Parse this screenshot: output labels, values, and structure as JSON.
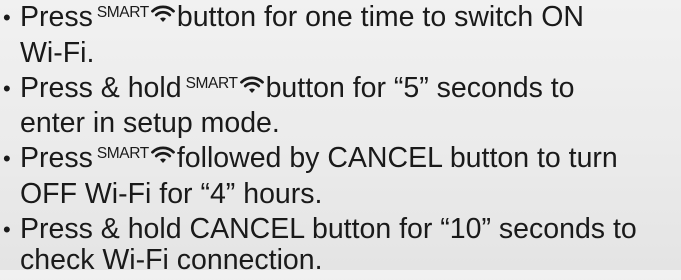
{
  "instructions": [
    {
      "line1_pre": "Press",
      "smart_label": "SMART",
      "icon": "wifi-icon",
      "line1_post": "button for one time to switch ON",
      "line2": "Wi-Fi."
    },
    {
      "line1_pre": "Press & hold",
      "smart_label": "SMART",
      "icon": "wifi-icon",
      "line1_post": "button for “5” seconds to",
      "line2": "enter in setup mode."
    },
    {
      "line1_pre": "Press",
      "smart_label": "SMART",
      "icon": "wifi-icon",
      "line1_post": "followed by CANCEL button to turn",
      "line2": "OFF Wi-Fi for “4” hours."
    },
    {
      "line1": "Press & hold CANCEL button for “10” seconds to",
      "line2": "check Wi-Fi connection."
    }
  ]
}
